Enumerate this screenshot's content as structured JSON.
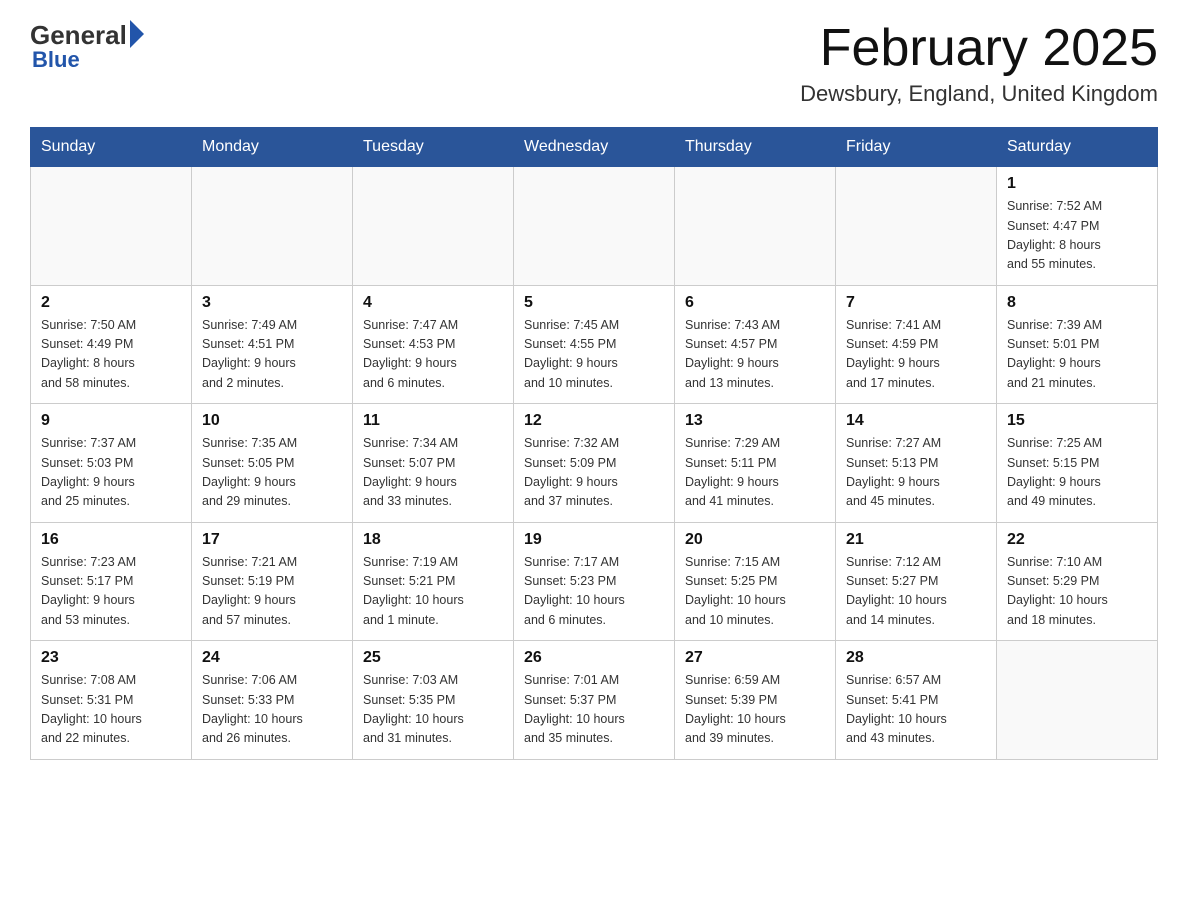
{
  "header": {
    "logo_general": "General",
    "logo_blue": "Blue",
    "month_title": "February 2025",
    "location": "Dewsbury, England, United Kingdom"
  },
  "weekdays": [
    "Sunday",
    "Monday",
    "Tuesday",
    "Wednesday",
    "Thursday",
    "Friday",
    "Saturday"
  ],
  "weeks": [
    [
      {
        "day": "",
        "info": ""
      },
      {
        "day": "",
        "info": ""
      },
      {
        "day": "",
        "info": ""
      },
      {
        "day": "",
        "info": ""
      },
      {
        "day": "",
        "info": ""
      },
      {
        "day": "",
        "info": ""
      },
      {
        "day": "1",
        "info": "Sunrise: 7:52 AM\nSunset: 4:47 PM\nDaylight: 8 hours\nand 55 minutes."
      }
    ],
    [
      {
        "day": "2",
        "info": "Sunrise: 7:50 AM\nSunset: 4:49 PM\nDaylight: 8 hours\nand 58 minutes."
      },
      {
        "day": "3",
        "info": "Sunrise: 7:49 AM\nSunset: 4:51 PM\nDaylight: 9 hours\nand 2 minutes."
      },
      {
        "day": "4",
        "info": "Sunrise: 7:47 AM\nSunset: 4:53 PM\nDaylight: 9 hours\nand 6 minutes."
      },
      {
        "day": "5",
        "info": "Sunrise: 7:45 AM\nSunset: 4:55 PM\nDaylight: 9 hours\nand 10 minutes."
      },
      {
        "day": "6",
        "info": "Sunrise: 7:43 AM\nSunset: 4:57 PM\nDaylight: 9 hours\nand 13 minutes."
      },
      {
        "day": "7",
        "info": "Sunrise: 7:41 AM\nSunset: 4:59 PM\nDaylight: 9 hours\nand 17 minutes."
      },
      {
        "day": "8",
        "info": "Sunrise: 7:39 AM\nSunset: 5:01 PM\nDaylight: 9 hours\nand 21 minutes."
      }
    ],
    [
      {
        "day": "9",
        "info": "Sunrise: 7:37 AM\nSunset: 5:03 PM\nDaylight: 9 hours\nand 25 minutes."
      },
      {
        "day": "10",
        "info": "Sunrise: 7:35 AM\nSunset: 5:05 PM\nDaylight: 9 hours\nand 29 minutes."
      },
      {
        "day": "11",
        "info": "Sunrise: 7:34 AM\nSunset: 5:07 PM\nDaylight: 9 hours\nand 33 minutes."
      },
      {
        "day": "12",
        "info": "Sunrise: 7:32 AM\nSunset: 5:09 PM\nDaylight: 9 hours\nand 37 minutes."
      },
      {
        "day": "13",
        "info": "Sunrise: 7:29 AM\nSunset: 5:11 PM\nDaylight: 9 hours\nand 41 minutes."
      },
      {
        "day": "14",
        "info": "Sunrise: 7:27 AM\nSunset: 5:13 PM\nDaylight: 9 hours\nand 45 minutes."
      },
      {
        "day": "15",
        "info": "Sunrise: 7:25 AM\nSunset: 5:15 PM\nDaylight: 9 hours\nand 49 minutes."
      }
    ],
    [
      {
        "day": "16",
        "info": "Sunrise: 7:23 AM\nSunset: 5:17 PM\nDaylight: 9 hours\nand 53 minutes."
      },
      {
        "day": "17",
        "info": "Sunrise: 7:21 AM\nSunset: 5:19 PM\nDaylight: 9 hours\nand 57 minutes."
      },
      {
        "day": "18",
        "info": "Sunrise: 7:19 AM\nSunset: 5:21 PM\nDaylight: 10 hours\nand 1 minute."
      },
      {
        "day": "19",
        "info": "Sunrise: 7:17 AM\nSunset: 5:23 PM\nDaylight: 10 hours\nand 6 minutes."
      },
      {
        "day": "20",
        "info": "Sunrise: 7:15 AM\nSunset: 5:25 PM\nDaylight: 10 hours\nand 10 minutes."
      },
      {
        "day": "21",
        "info": "Sunrise: 7:12 AM\nSunset: 5:27 PM\nDaylight: 10 hours\nand 14 minutes."
      },
      {
        "day": "22",
        "info": "Sunrise: 7:10 AM\nSunset: 5:29 PM\nDaylight: 10 hours\nand 18 minutes."
      }
    ],
    [
      {
        "day": "23",
        "info": "Sunrise: 7:08 AM\nSunset: 5:31 PM\nDaylight: 10 hours\nand 22 minutes."
      },
      {
        "day": "24",
        "info": "Sunrise: 7:06 AM\nSunset: 5:33 PM\nDaylight: 10 hours\nand 26 minutes."
      },
      {
        "day": "25",
        "info": "Sunrise: 7:03 AM\nSunset: 5:35 PM\nDaylight: 10 hours\nand 31 minutes."
      },
      {
        "day": "26",
        "info": "Sunrise: 7:01 AM\nSunset: 5:37 PM\nDaylight: 10 hours\nand 35 minutes."
      },
      {
        "day": "27",
        "info": "Sunrise: 6:59 AM\nSunset: 5:39 PM\nDaylight: 10 hours\nand 39 minutes."
      },
      {
        "day": "28",
        "info": "Sunrise: 6:57 AM\nSunset: 5:41 PM\nDaylight: 10 hours\nand 43 minutes."
      },
      {
        "day": "",
        "info": ""
      }
    ]
  ]
}
